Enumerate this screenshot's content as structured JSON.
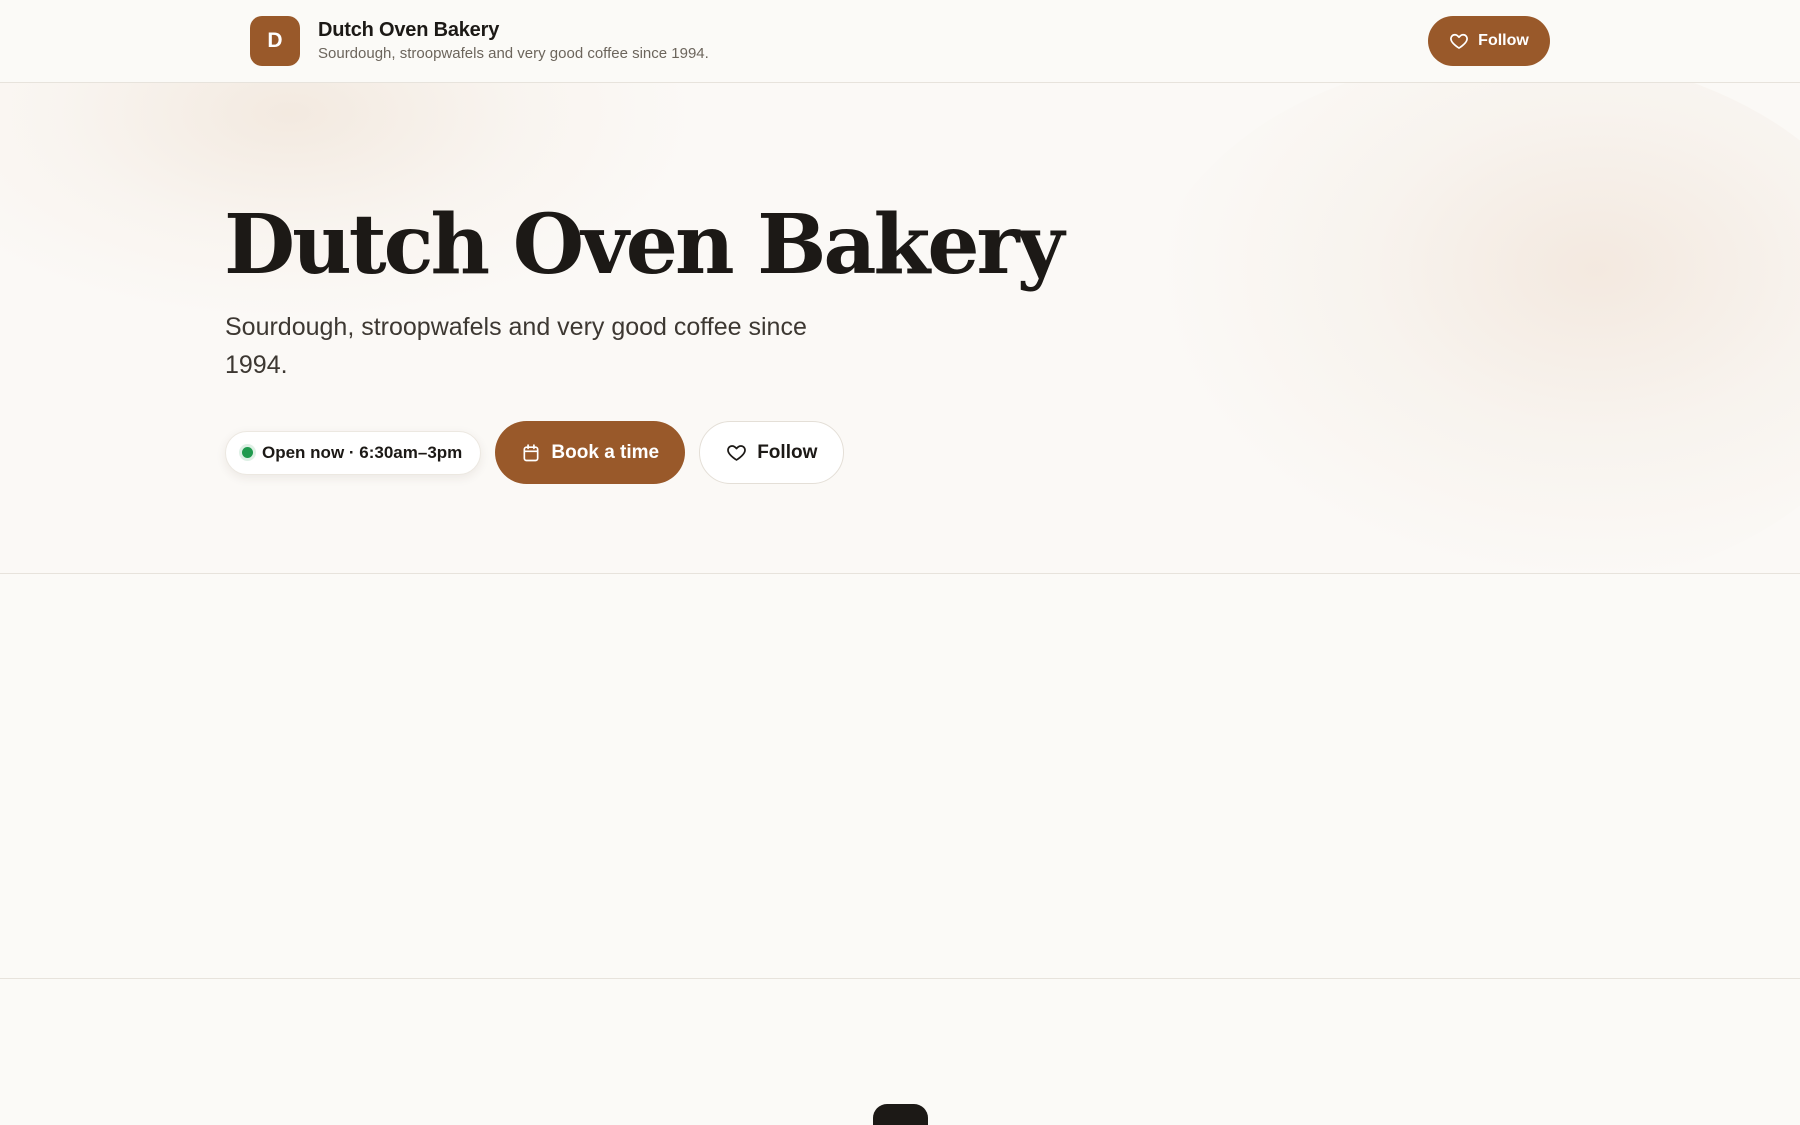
{
  "topbar": {
    "logo_letter": "D",
    "brand_name": "Dutch Oven Bakery",
    "tagline": "Sourdough, stroopwafels and very good coffee since 1994.",
    "follow_label": "Follow"
  },
  "hero": {
    "title": "Dutch Oven Bakery",
    "subtitle": "Sourdough, stroopwafels and very good coffee since 1994.",
    "status": "Open now · 6:30am–3pm",
    "book_label": "Book a time",
    "follow_label": "Follow"
  },
  "icons": {
    "follow": "heart-icon",
    "book": "calendar-icon",
    "status": "status-dot"
  },
  "colors": {
    "accent": "#99592a",
    "background": "#fbfaf7",
    "text": "#1c1916",
    "status_open": "#1f9a4e"
  }
}
